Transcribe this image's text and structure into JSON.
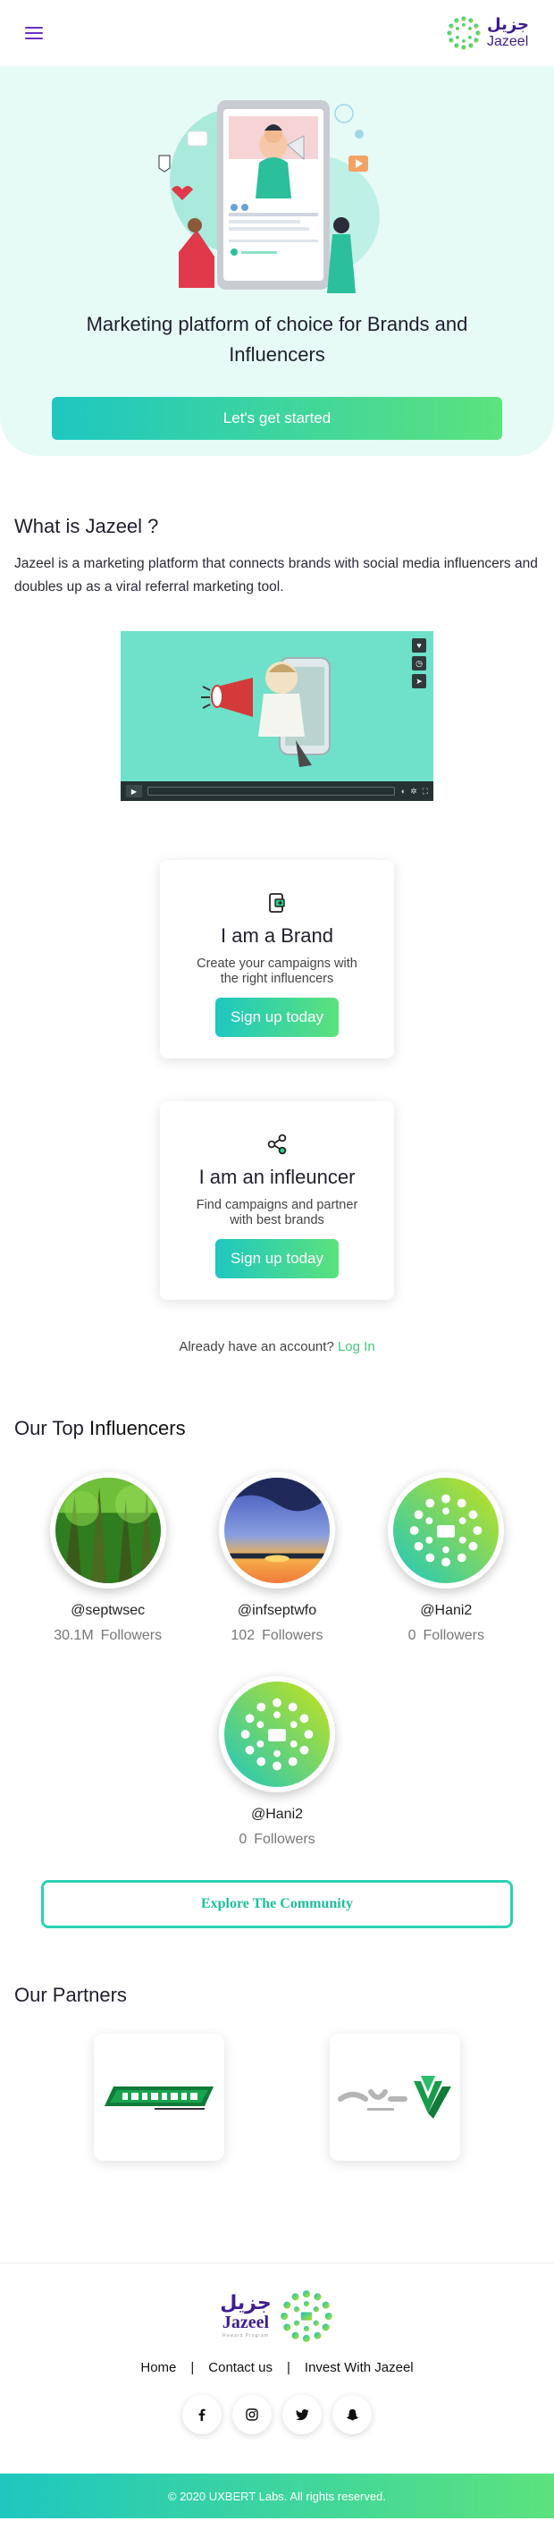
{
  "header": {
    "menu_icon": "hamburger-icon",
    "logo": {
      "arabic": "جزيل",
      "english": "Jazeel"
    }
  },
  "hero": {
    "title": "Marketing platform of choice for Brands and Influencers",
    "cta_label": "Let's get started"
  },
  "about": {
    "heading": "What is Jazeel ?",
    "text": "Jazeel is a marketing platform that connects brands with social media influencers and doubles up as a viral referral marketing tool."
  },
  "signup_cards": [
    {
      "icon": "brand-icon",
      "title": "I am a Brand",
      "description": "Create your campaigns with the right influencers",
      "button": "Sign up today"
    },
    {
      "icon": "share-icon",
      "title": "I am an infleuncer",
      "description": "Find campaigns and partner with best brands",
      "button": "Sign up today"
    }
  ],
  "login": {
    "prompt": "Already have an account?",
    "link": "Log In"
  },
  "influencers": {
    "heading_prefix": "Our Top",
    "heading_strong": "Influencers",
    "followers_label": "Followers",
    "items": [
      {
        "handle": "@septwsec",
        "followers": "30.1M"
      },
      {
        "handle": "@infseptwfo",
        "followers": "102"
      },
      {
        "handle": "@Hani2",
        "followers": "0"
      },
      {
        "handle": "@Hani2",
        "followers": "0"
      }
    ],
    "explore_label": "Explore The Community"
  },
  "partners": {
    "heading": "Our Partners"
  },
  "footer": {
    "logo": {
      "arabic": "جزيل",
      "english": "Jazeel",
      "tagline": "Reward Program"
    },
    "nav": [
      "Home",
      "Contact us",
      "Invest With Jazeel"
    ],
    "social": [
      "facebook-icon",
      "instagram-icon",
      "twitter-icon",
      "snapchat-icon"
    ],
    "copyright": "© 2020 UXBERT Labs. All rights reserved."
  },
  "colors": {
    "primary_gradient_start": "#1ec7c0",
    "primary_gradient_end": "#5ce27d",
    "brand_purple": "#3d1d8f",
    "hero_bg": "#e6faf6"
  }
}
